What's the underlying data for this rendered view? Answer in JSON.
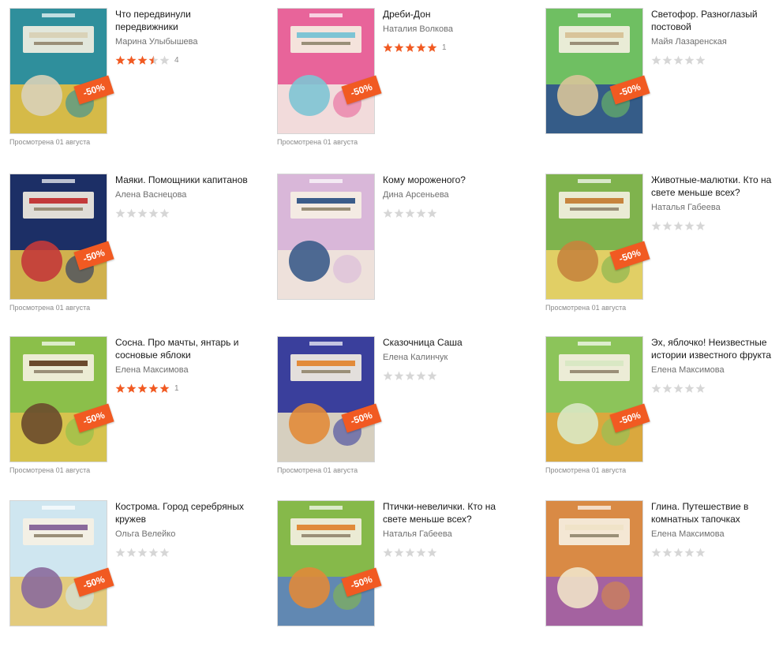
{
  "colors": {
    "accent": "#f15a22",
    "star_on": "#f15a22",
    "star_off": "#d6d6d6"
  },
  "books": [
    {
      "title": "Что передвинули передвижники",
      "author": "Марина Улыбышева",
      "rating": 3.5,
      "rating_count": "4",
      "badge": "-50%",
      "viewed": "Просмотрена 01 августа",
      "cover": [
        "#2f8f9c",
        "#f2c23a",
        "#d9d2b8"
      ]
    },
    {
      "title": "Дреби-Дон",
      "author": "Наталия Волкова",
      "rating": 5,
      "rating_count": "1",
      "badge": "-50%",
      "viewed": "Просмотрена 01 августа",
      "cover": [
        "#e8649a",
        "#f3f0e6",
        "#7ec4d4"
      ]
    },
    {
      "title": "Светофор. Разноглазый постовой",
      "author": "Майя Лазаренская",
      "rating": 0,
      "rating_count": "",
      "badge": "-50%",
      "viewed": "",
      "cover": [
        "#6fbf62",
        "#2c4a8f",
        "#d8c49a"
      ]
    },
    {
      "title": "Маяки. Помощники капитанов",
      "author": "Алена Васнецова",
      "rating": 0,
      "rating_count": "",
      "badge": "-50%",
      "viewed": "Просмотрена 01 августа",
      "cover": [
        "#1c2f66",
        "#f0c84a",
        "#c33a3a"
      ]
    },
    {
      "title": "Кому мороженого?",
      "author": "Дина Арсеньева",
      "rating": 0,
      "rating_count": "",
      "badge": "",
      "viewed": "",
      "cover": [
        "#d9b7d9",
        "#f1e9da",
        "#3b5c8a"
      ]
    },
    {
      "title": "Животные-малютки. Кто на свете меньше всех?",
      "author": "Наталья Габеева",
      "rating": 0,
      "rating_count": "",
      "badge": "-50%",
      "viewed": "Просмотрена 01 августа",
      "cover": [
        "#7fb34d",
        "#f2d36a",
        "#c7843d"
      ]
    },
    {
      "title": "Сосна. Про мачты, янтарь и сосновые яблоки",
      "author": "Елена Максимова",
      "rating": 5,
      "rating_count": "1",
      "badge": "-50%",
      "viewed": "Просмотрена 01 августа",
      "cover": [
        "#8bbf4a",
        "#e3c34f",
        "#6a4a2c"
      ]
    },
    {
      "title": "Сказочница Саша",
      "author": "Елена Калинчук",
      "rating": 0,
      "rating_count": "",
      "badge": "-50%",
      "viewed": "Просмотрена 01 августа",
      "cover": [
        "#3a3f9c",
        "#f2e9c6",
        "#e28b3a"
      ]
    },
    {
      "title": "Эх, яблочко! Неизвестные истории известного фрукта",
      "author": "Елена Максимова",
      "rating": 0,
      "rating_count": "",
      "badge": "-50%",
      "viewed": "Просмотрена 01 августа",
      "cover": [
        "#8cc45a",
        "#e8a33a",
        "#d9e8c4"
      ]
    },
    {
      "title": "Кострома. Город серебряных кружев",
      "author": "Ольга Велейко",
      "rating": 0,
      "rating_count": "",
      "badge": "-50%",
      "viewed": "",
      "cover": [
        "#cfe6f0",
        "#e6c56a",
        "#8a6a9c"
      ]
    },
    {
      "title": "Птички-невелички. Кто на свете меньше всех?",
      "author": "Наталья Габеева",
      "rating": 0,
      "rating_count": "",
      "badge": "-50%",
      "viewed": "",
      "cover": [
        "#86b94a",
        "#5a7fc4",
        "#e08a3a"
      ]
    },
    {
      "title": "Глина. Путешествие в комнатных тапочках",
      "author": "Елена Максимова",
      "rating": 0,
      "rating_count": "",
      "badge": "",
      "viewed": "",
      "cover": [
        "#d98a45",
        "#9a5bb0",
        "#f0e3c8"
      ]
    }
  ]
}
